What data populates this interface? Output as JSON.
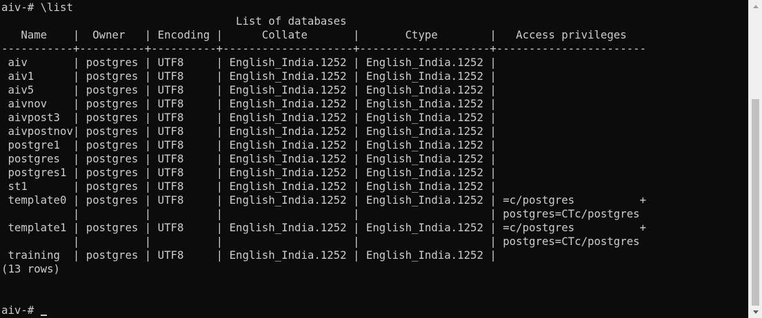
{
  "terminal": {
    "command_line": "aiv-# \\list",
    "lines": [
      "                                    List of databases",
      "   Name    |  Owner   | Encoding |      Collate       |       Ctype        |   Access privileges",
      "-----------+----------+----------+--------------------+--------------------+-----------------------",
      " aiv       | postgres | UTF8     | English_India.1252 | English_India.1252 |",
      " aiv1      | postgres | UTF8     | English_India.1252 | English_India.1252 |",
      " aiv5      | postgres | UTF8     | English_India.1252 | English_India.1252 |",
      " aivnov    | postgres | UTF8     | English_India.1252 | English_India.1252 |",
      " aivpost3  | postgres | UTF8     | English_India.1252 | English_India.1252 |",
      " aivpostnov| postgres | UTF8     | English_India.1252 | English_India.1252 |",
      " postgre1  | postgres | UTF8     | English_India.1252 | English_India.1252 |",
      " postgres  | postgres | UTF8     | English_India.1252 | English_India.1252 |",
      " postgres1 | postgres | UTF8     | English_India.1252 | English_India.1252 |",
      " st1       | postgres | UTF8     | English_India.1252 | English_India.1252 |",
      " template0 | postgres | UTF8     | English_India.1252 | English_India.1252 | =c/postgres          +",
      "           |          |          |                    |                    | postgres=CTc/postgres",
      " template1 | postgres | UTF8     | English_India.1252 | English_India.1252 | =c/postgres          +",
      "           |          |          |                    |                    | postgres=CTc/postgres",
      " training  | postgres | UTF8     | English_India.1252 | English_India.1252 |",
      "(13 rows)"
    ],
    "prompt": "aiv-# "
  },
  "colors": {
    "background": "#0c0c0c",
    "text": "#cccccc",
    "scrollbar": "#f0f0f0"
  },
  "icons": {
    "scroll_up": "triangle-up-icon",
    "scroll_down": "triangle-down-icon"
  }
}
